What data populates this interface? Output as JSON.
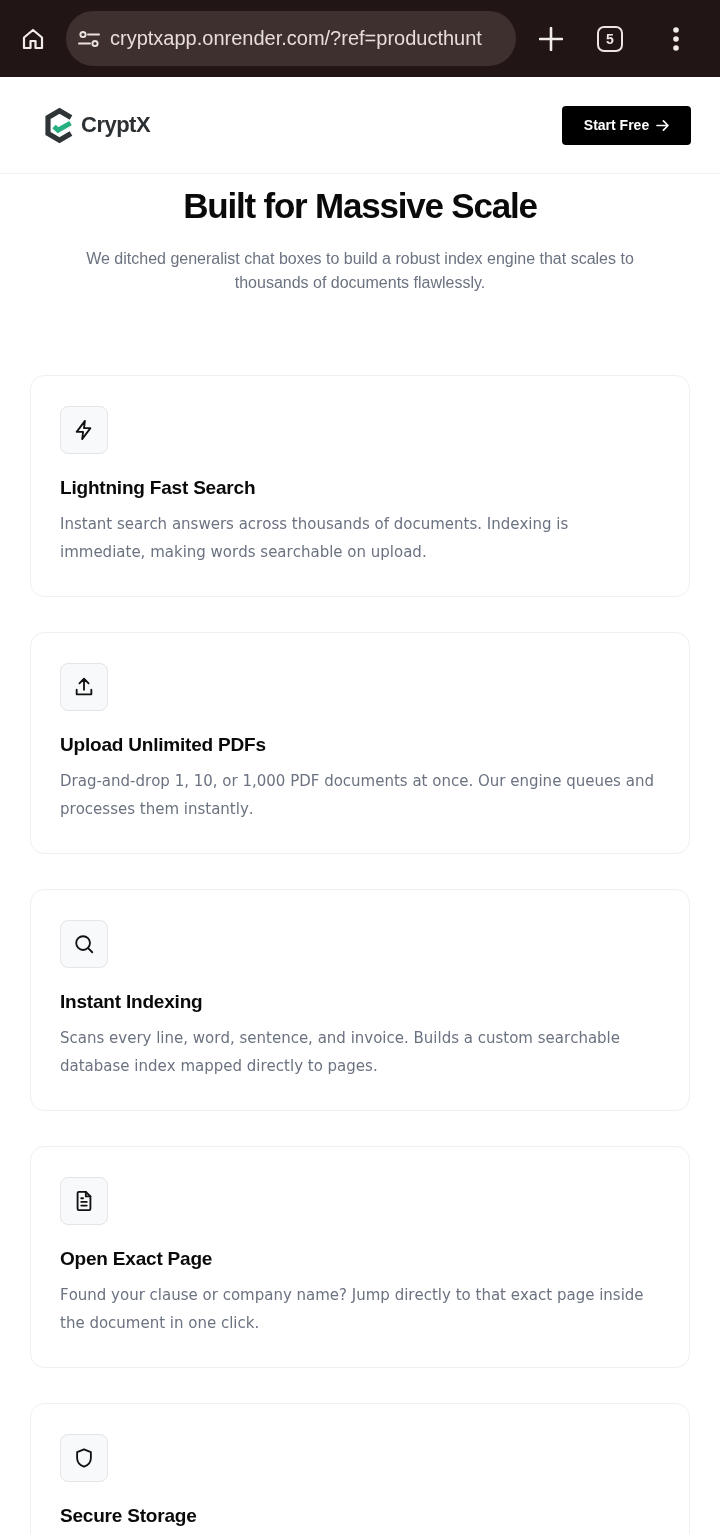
{
  "browser_bar": {
    "url": "cryptxapp.onrender.com/?ref=producthunt",
    "tab_count": "5"
  },
  "header": {
    "brand": "CryptX",
    "cta": "Start Free"
  },
  "section": {
    "title": "Built for Massive Scale",
    "subtitle": "We ditched generalist chat boxes to build a robust index engine that scales to thousands of documents flawlessly."
  },
  "features": [
    {
      "kind": "lightning",
      "title": "Lightning Fast Search",
      "description": "Instant search answers across thousands of documents. Indexing is immediate, making words searchable on upload."
    },
    {
      "kind": "upload",
      "title": "Upload Unlimited PDFs",
      "description": "Drag-and-drop 1, 10, or 1,000 PDF documents at once. Our engine queues and processes them instantly."
    },
    {
      "kind": "search",
      "title": "Instant Indexing",
      "description": "Scans every line, word, sentence, and invoice. Builds a custom searchable database index mapped directly to pages."
    },
    {
      "kind": "document",
      "title": "Open Exact Page",
      "description": "Found your clause or company name? Jump directly to that exact page inside the document in one click."
    },
    {
      "kind": "shield",
      "title": "Secure Storage"
    }
  ]
}
